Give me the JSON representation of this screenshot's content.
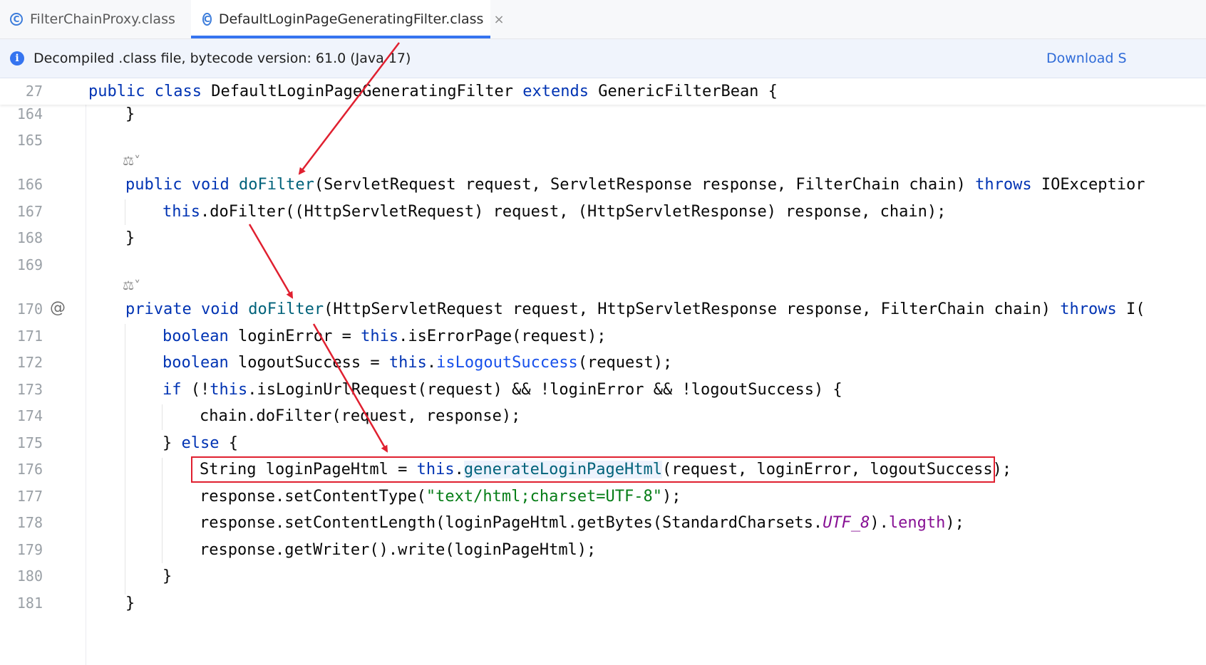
{
  "tabs": [
    {
      "label": "FilterChainProxy.class",
      "icon": "class-icon"
    },
    {
      "label": "DefaultLoginPageGeneratingFilter.class",
      "icon": "class-icon",
      "close": "×"
    }
  ],
  "banner": {
    "message": "Decompiled .class file, bytecode version: 61.0 (Java 17)",
    "action": "Download S"
  },
  "sticky_line": {
    "number": "27",
    "t1": "public class",
    "t2": " DefaultLoginPageGeneratingFilter ",
    "t3": "extends",
    "t4": " GenericFilterBean {"
  },
  "lines": {
    "l164": {
      "n": "164",
      "a": "}"
    },
    "l165": {
      "n": "165"
    },
    "l166": {
      "n": "166",
      "a": "public void",
      "b": " ",
      "c": "doFilter",
      "d": "(ServletRequest request, ServletResponse response, FilterChain chain) ",
      "e": "throws",
      "f": " IOExceptior"
    },
    "l167": {
      "n": "167",
      "a": "this",
      "b": ".doFilter((HttpServletRequest) request, (HttpServletResponse) response, chain);"
    },
    "l168": {
      "n": "168",
      "a": "}"
    },
    "l169": {
      "n": "169"
    },
    "l170": {
      "n": "170",
      "a": "private void",
      "b": " ",
      "c": "doFilter",
      "d": "(HttpServletRequest request, HttpServletResponse response, FilterChain chain) ",
      "e": "throws",
      "f": " I("
    },
    "l171": {
      "n": "171",
      "a": "boolean",
      "b": " loginError = ",
      "c": "this",
      "d": ".isErrorPage(request);"
    },
    "l172": {
      "n": "172",
      "a": "boolean",
      "b": " logoutSuccess = ",
      "c": "this",
      "d": ".",
      "e": "isLogoutSuccess",
      "f": "(request);"
    },
    "l173": {
      "n": "173",
      "a": "if",
      "b": " (!",
      "c": "this",
      "d": ".isLoginUrlRequest(request) && !loginError && !logoutSuccess) {"
    },
    "l174": {
      "n": "174",
      "a": "chain.doFilter(request, response);"
    },
    "l175": {
      "n": "175",
      "a": "} ",
      "b": "else",
      "c": " {"
    },
    "l176": {
      "n": "176",
      "a": "String loginPageHtml = ",
      "b": "this",
      "c": ".",
      "d": "generateLoginPageHtml",
      "e": "(request, loginError, logoutSuccess);"
    },
    "l177": {
      "n": "177",
      "a": "response.setContentType(",
      "b": "\"text/html;charset=UTF-8\"",
      "c": ");"
    },
    "l178": {
      "n": "178",
      "a": "response.setContentLength(loginPageHtml.getBytes(StandardCharsets.",
      "b": "UTF_8",
      "c": ").",
      "d": "length",
      "e": ");"
    },
    "l179": {
      "n": "179",
      "a": "response.getWriter().write(loginPageHtml);"
    },
    "l180": {
      "n": "180",
      "a": "}"
    },
    "l181": {
      "n": "181",
      "a": "}"
    }
  },
  "gutter_marker": "@",
  "hint_icon": "ai-inline-hint-icon",
  "colors": {
    "accent": "#3574f0",
    "keyword": "#0033b3",
    "method": "#00627a",
    "string": "#067d17",
    "field": "#871094",
    "annotation_red": "#e02030"
  }
}
